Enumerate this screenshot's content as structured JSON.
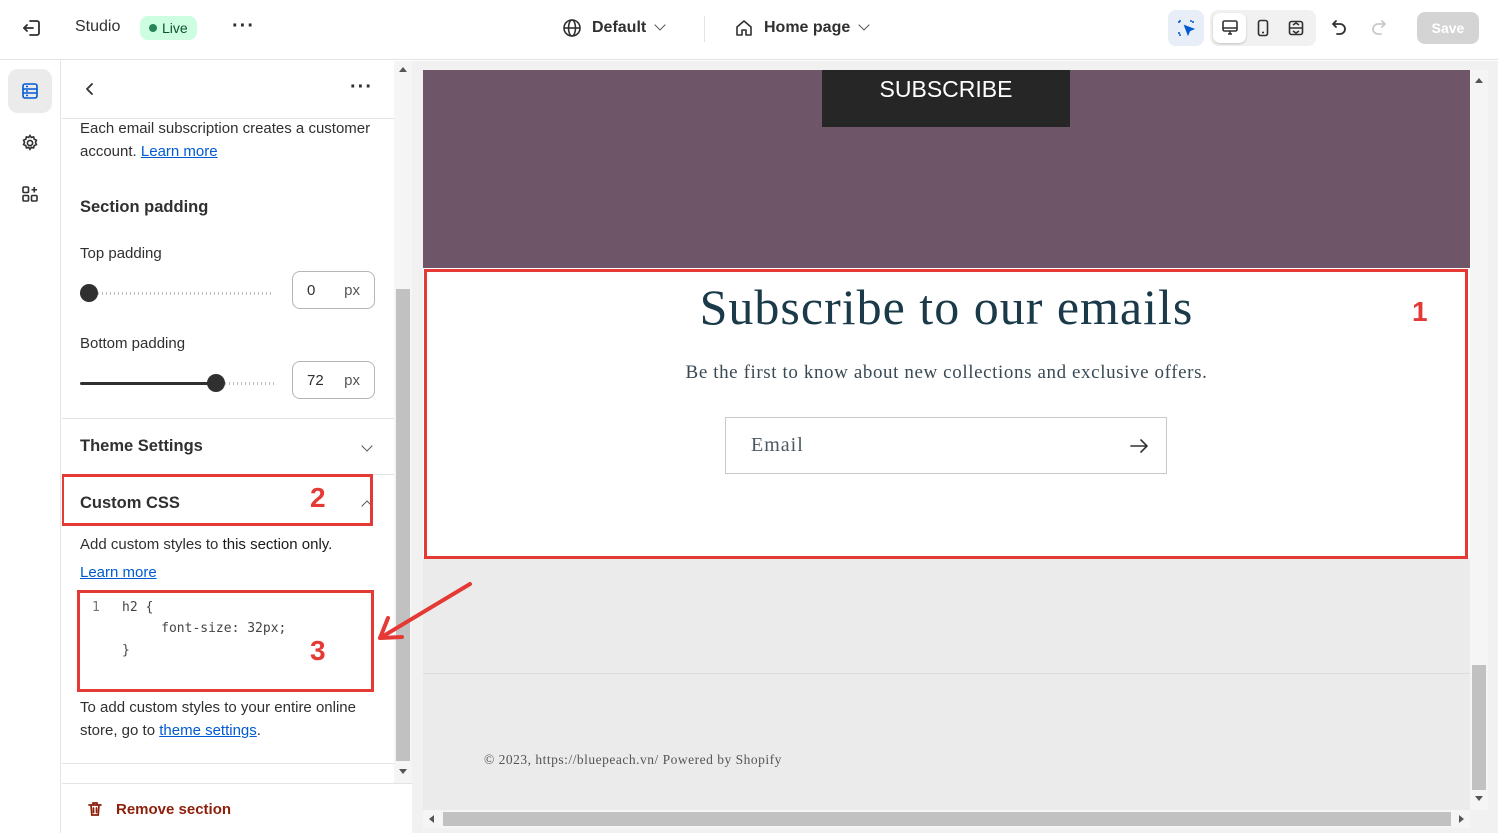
{
  "topbar": {
    "app_name": "Studio",
    "status_badge": "Live",
    "theme_selector": "Default",
    "page_selector": "Home page",
    "save_label": "Save"
  },
  "sidebar": {
    "subscription_note": "Each email subscription creates a customer account.",
    "learn_more_1": "Learn more",
    "section_padding_heading": "Section padding",
    "top_padding_label": "Top padding",
    "top_padding_value": "0",
    "top_padding_fraction": 0,
    "bottom_padding_label": "Bottom padding",
    "bottom_padding_value": "72",
    "bottom_padding_fraction": 0.72,
    "unit": "px",
    "theme_settings_heading": "Theme Settings",
    "custom_css_heading": "Custom CSS",
    "custom_css_help_prefix": "Add custom styles to ",
    "custom_css_help_bold": "this section only.",
    "learn_more_2": "Learn more",
    "code_lines": [
      {
        "num": "1",
        "text": "h2 {"
      },
      {
        "num": "",
        "text": "     font-size: 32px;"
      },
      {
        "num": "",
        "text": "}"
      }
    ],
    "global_css_prefix": "To add custom styles to your entire online store, go to ",
    "global_css_link": "theme settings",
    "global_css_suffix": ".",
    "remove_section": "Remove section"
  },
  "preview": {
    "subscribe_button": "SUBSCRIBE",
    "newsletter_title": "Subscribe to our emails",
    "newsletter_subtitle": "Be the first to know about new collections and exclusive offers.",
    "email_placeholder": "Email",
    "copyright": "© 2023, https://bluepeach.vn/ Powered by Shopify"
  },
  "annotations": {
    "label_1": "1",
    "label_2": "2",
    "label_3": "3",
    "color": "#e53935"
  },
  "colors": {
    "accent_link": "#005bd3",
    "live_badge_bg": "#cdfee1",
    "purple_banner": "#6e5567",
    "remove_red": "#8e1f0b"
  }
}
